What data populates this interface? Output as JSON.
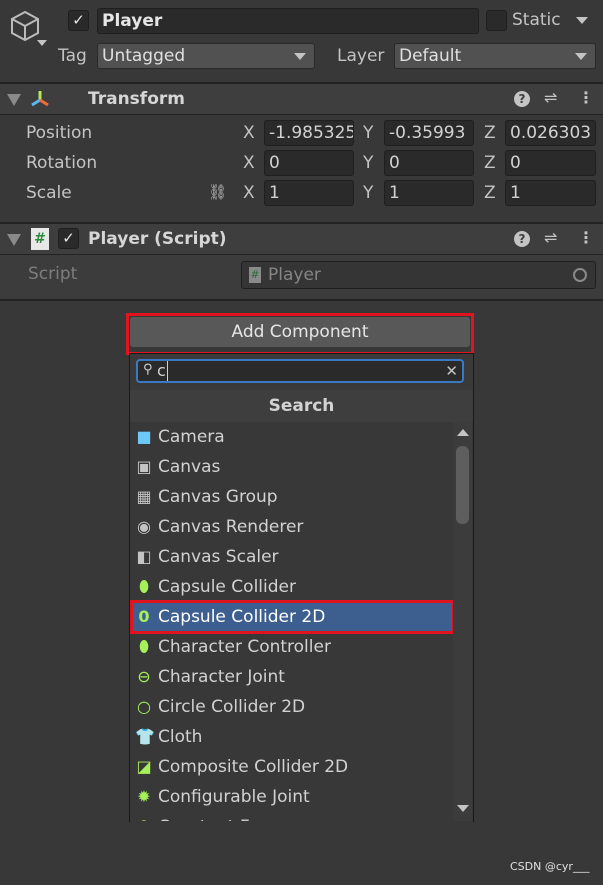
{
  "object": {
    "name": "Player",
    "active": true,
    "static_label": "Static",
    "static": false,
    "tag_label": "Tag",
    "tag": "Untagged",
    "layer_label": "Layer",
    "layer": "Default"
  },
  "transform": {
    "title": "Transform",
    "rows": [
      {
        "label": "Position",
        "x": "-1.985325",
        "y": "-0.35993",
        "z": "0.026303"
      },
      {
        "label": "Rotation",
        "x": "0",
        "y": "0",
        "z": "0"
      },
      {
        "label": "Scale",
        "x": "1",
        "y": "1",
        "z": "1"
      }
    ],
    "axes": [
      "X",
      "Y",
      "Z"
    ]
  },
  "script_component": {
    "title": "Player (Script)",
    "enabled": true,
    "field_label": "Script",
    "field_value": "Player"
  },
  "add_component": {
    "label": "Add Component",
    "search_value": "c",
    "section": "Search",
    "items": [
      {
        "label": "Camera",
        "icon": "camera-icon",
        "color": "#6dc8f7"
      },
      {
        "label": "Canvas",
        "icon": "canvas-icon",
        "color": "#c4c4c4"
      },
      {
        "label": "Canvas Group",
        "icon": "canvas-group-icon",
        "color": "#c4c4c4"
      },
      {
        "label": "Canvas Renderer",
        "icon": "eye-icon",
        "color": "#c4c4c4"
      },
      {
        "label": "Canvas Scaler",
        "icon": "canvas-scaler-icon",
        "color": "#c4c4c4"
      },
      {
        "label": "Capsule Collider",
        "icon": "capsule-collider-icon",
        "color": "#a6f05a"
      },
      {
        "label": "Capsule Collider 2D",
        "icon": "capsule-collider-2d-icon",
        "color": "#a6f05a",
        "selected": true
      },
      {
        "label": "Character Controller",
        "icon": "character-controller-icon",
        "color": "#a6f05a"
      },
      {
        "label": "Character Joint",
        "icon": "character-joint-icon",
        "color": "#a6f05a"
      },
      {
        "label": "Circle Collider 2D",
        "icon": "circle-collider-icon",
        "color": "#a6f05a"
      },
      {
        "label": "Cloth",
        "icon": "cloth-icon",
        "color": "#a6f05a"
      },
      {
        "label": "Composite Collider 2D",
        "icon": "composite-collider-icon",
        "color": "#a6f05a"
      },
      {
        "label": "Configurable Joint",
        "icon": "configurable-joint-icon",
        "color": "#a6f05a"
      },
      {
        "label": "Constant Force",
        "icon": "constant-force-icon",
        "color": "#a6f05a"
      }
    ]
  },
  "watermark": "CSDN @cyr___",
  "colors": {
    "selection": "#3d5f8f",
    "highlight_box": "#e0141e",
    "focus": "#3a79c4"
  }
}
